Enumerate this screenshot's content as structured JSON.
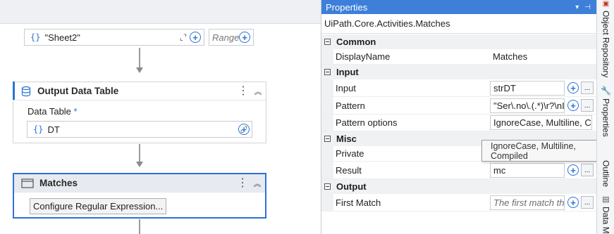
{
  "designer": {
    "sheet_field_value": "\"Sheet2\"",
    "range_placeholder": "Range",
    "output_card": {
      "title": "Output Data Table",
      "data_table_label": "Data Table",
      "required_mark": "*",
      "data_table_value": "DT"
    },
    "matches_card": {
      "title": "Matches",
      "configure_button": "Configure Regular Expression..."
    }
  },
  "properties": {
    "panel_title": "Properties",
    "type_name": "UiPath.Core.Activities.Matches",
    "categories": [
      {
        "name": "Common",
        "rows": [
          {
            "label": "DisplayName",
            "value": "Matches",
            "kind": "text"
          }
        ]
      },
      {
        "name": "Input",
        "rows": [
          {
            "label": "Input",
            "value": "strDT",
            "kind": "expr"
          },
          {
            "label": "Pattern",
            "value": "\"Ser\\.no\\.(.*)\\r?\\nIr",
            "kind": "expr"
          },
          {
            "label": "Pattern options",
            "value": "IgnoreCase, Multiline, C",
            "kind": "combo"
          }
        ]
      },
      {
        "name": "Misc",
        "rows": [
          {
            "label": "Private",
            "value": "",
            "kind": "blank"
          },
          {
            "label": "Result",
            "value": "mc",
            "kind": "expr"
          }
        ]
      },
      {
        "name": "Output",
        "rows": [
          {
            "label": "First Match",
            "value": "The first match tha",
            "kind": "placeholder"
          }
        ]
      }
    ],
    "tooltip": "IgnoreCase, Multiline, Compiled",
    "ellipsis_label": "..."
  },
  "side_tabs": [
    "Object Repository",
    "Properties",
    "Outline",
    "Data M"
  ]
}
